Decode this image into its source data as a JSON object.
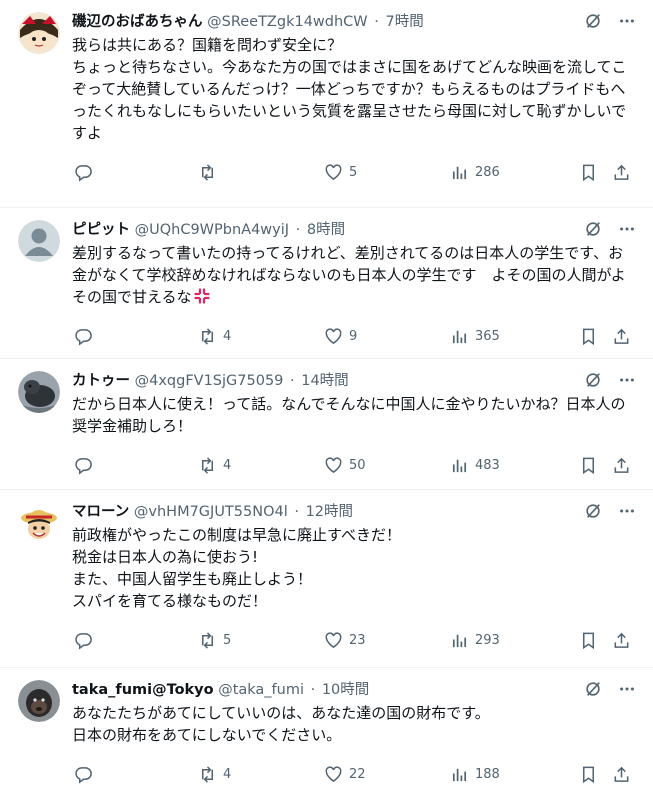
{
  "posts": [
    {
      "name": "磯辺のおばあちゃん",
      "handle": "@SReeTZgk14wdhCW",
      "time": "7時間",
      "text": "我らは共にある？国籍を問わず安全に？\nちょっと待ちなさい。今あなた方の国ではまさに国をあげてどんな映画を流してこぞって大絶賛しているんだっけ？一体どっちですか？もらえるものはプライドもへったくれもなしにもらいたいという気質を露呈させたら母国に対して恥ずかしいですよ",
      "replies": "",
      "reposts": "",
      "likes": "5",
      "views": "286",
      "avatar": "yukkuri"
    },
    {
      "name": "ピピット",
      "handle": "@UQhC9WPbnA4wyiJ",
      "time": "8時間",
      "text": "差別するなって書いたの持ってるけれど、差別されてるのは日本人の学生です、お金がなくて学校辞めなければならないのも日本人の学生です　よその国の人間がよその国で甘えるな",
      "emoji": "anger-icon",
      "replies": "",
      "reposts": "4",
      "likes": "9",
      "views": "365",
      "avatar": "default"
    },
    {
      "name": "カトゥー",
      "handle": "@4xqgFV1SjG75059",
      "time": "14時間",
      "text": "だから日本人に使え！って話。なんでそんなに中国人に金やりたいかね？日本人の奨学金補助しろ！",
      "replies": "",
      "reposts": "4",
      "likes": "50",
      "views": "483",
      "avatar": "animal"
    },
    {
      "name": "マローン",
      "handle": "@vhHM7GJUT55NO4l",
      "time": "12時間",
      "text": "前政権がやったこの制度は早急に廃止すべきだ！\n税金は日本人の為に使おう!\nまた、中国人留学生も廃止しよう！\nスパイを育てる様なものだ！",
      "replies": "",
      "reposts": "5",
      "likes": "23",
      "views": "293",
      "avatar": "luffy"
    },
    {
      "name": "taka_fumi@Tokyo",
      "handle": "@taka_fumi",
      "time": "10時間",
      "text": "あなたたちがあてにしていいのは、あなた達の国の財布です。\n日本の財布をあてにしないでください。",
      "replies": "",
      "reposts": "4",
      "likes": "22",
      "views": "188",
      "avatar": "gorilla"
    }
  ],
  "separator": "·",
  "colors": {
    "text": "#0f1419",
    "muted": "#536471",
    "border": "#eff3f4",
    "anger": "#e0245e"
  }
}
